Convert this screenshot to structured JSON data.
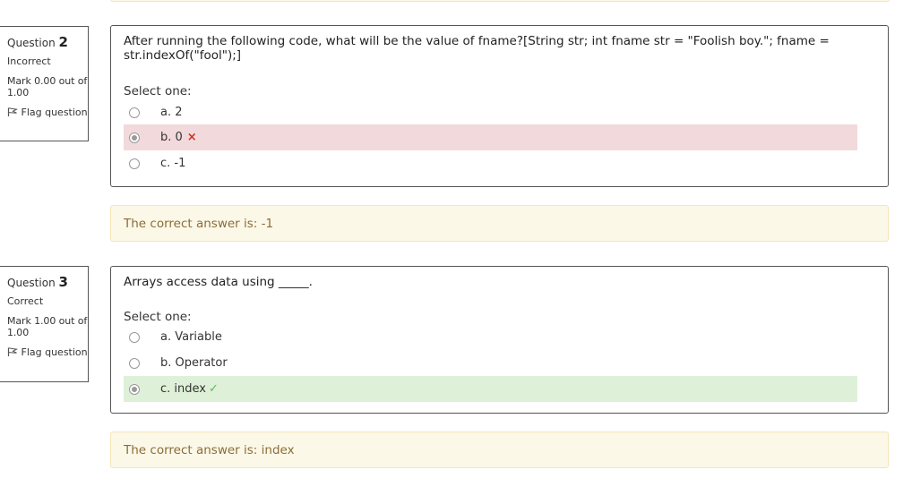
{
  "questions": [
    {
      "number_label": "Question",
      "number": "2",
      "state": "Incorrect",
      "grade": "Mark 0.00 out of 1.00",
      "flag_label": "Flag question",
      "text": "After running the following code, what will be the value of fname?[String str; int fname str = \"Foolish boy.\"; fname = str.indexOf(\"fool\");]",
      "prompt": "Select one:",
      "options": [
        {
          "label": "a. 2",
          "checked": false,
          "status": "none"
        },
        {
          "label": "b. 0",
          "checked": true,
          "status": "incorrect"
        },
        {
          "label": "c. -1",
          "checked": false,
          "status": "none"
        }
      ],
      "feedback": "The correct answer is: -1"
    },
    {
      "number_label": "Question",
      "number": "3",
      "state": "Correct",
      "grade": "Mark 1.00 out of 1.00",
      "flag_label": "Flag question",
      "text": "Arrays access data using _____.",
      "prompt": "Select one:",
      "options": [
        {
          "label": "a. Variable",
          "checked": false,
          "status": "none"
        },
        {
          "label": "b. Operator",
          "checked": false,
          "status": "none"
        },
        {
          "label": "c. index",
          "checked": true,
          "status": "correct"
        }
      ],
      "feedback": "The correct answer is: index"
    }
  ],
  "icons": {
    "flag": "flag-icon",
    "incorrect": "cross-icon",
    "correct": "check-icon"
  },
  "colors": {
    "incorrect_bg": "#f2d9db",
    "correct_bg": "#dff0d8",
    "incorrect_mark": "#ca3120",
    "correct_mark": "#5cb85c",
    "feedback_bg": "#fcf8e7",
    "feedback_text": "#8a6d3b"
  },
  "symbols": {
    "cross": "×",
    "check": "✓"
  }
}
